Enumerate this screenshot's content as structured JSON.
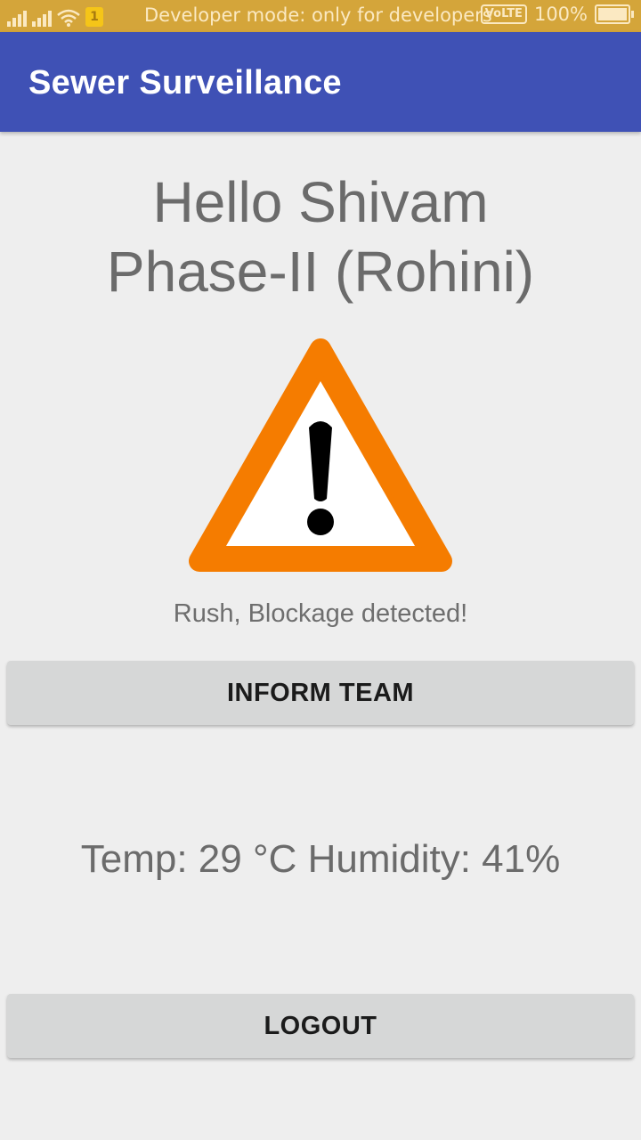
{
  "status_bar": {
    "sim_label": "1",
    "developer_notice": "Developer mode: only for developers",
    "volte_label": "VoLTE",
    "battery": "100%"
  },
  "app_bar": {
    "title": "Sewer Surveillance"
  },
  "greeting": {
    "line1": "Hello Shivam",
    "line2": "Phase-II (Rohini)"
  },
  "alert": {
    "message": "Rush, Blockage detected!"
  },
  "buttons": {
    "inform_team": "INFORM TEAM",
    "logout": "LOGOUT"
  },
  "readings": {
    "text": "Temp: 29 °C Humidity: 41%"
  },
  "icons": {
    "warning": "warning-triangle-icon",
    "wifi": "wifi-icon",
    "signal": "signal-icon",
    "battery": "battery-icon"
  },
  "colors": {
    "app_bar": "#3f51b5",
    "status_bar": "#d4a53a",
    "warning_border": "#f57c00",
    "button": "#d6d7d7",
    "background": "#eeeeee"
  }
}
